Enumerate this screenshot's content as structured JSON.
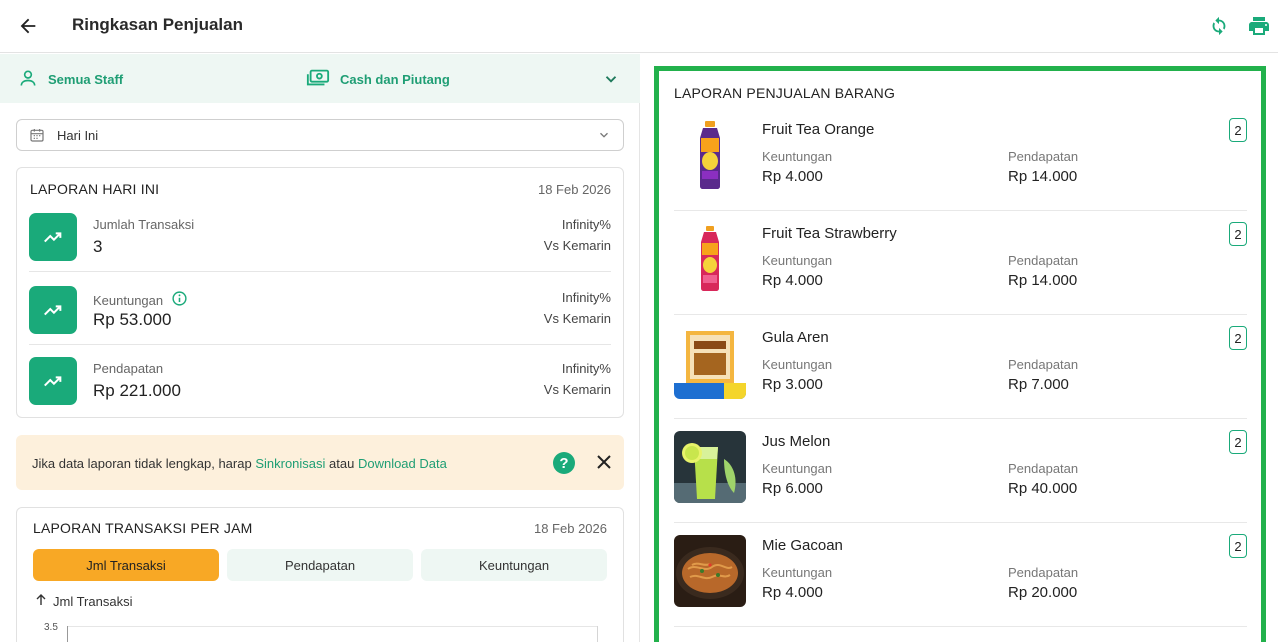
{
  "header": {
    "title": "Ringkasan Penjualan",
    "back_icon": "arrow-left-icon",
    "refresh_icon": "refresh-icon",
    "print_icon": "printer-icon"
  },
  "filters": {
    "staff_label": "Semua Staff",
    "payment_label": "Cash dan Piutang"
  },
  "date_select": {
    "value": "Hari Ini"
  },
  "today_report": {
    "title": "LAPORAN HARI INI",
    "date": "18 Feb 2026",
    "stats": [
      {
        "label": "Jumlah Transaksi",
        "value": "3",
        "pct": "Infinity%",
        "vs": "Vs Kemarin"
      },
      {
        "label": "Keuntungan",
        "value": "Rp 53.000",
        "pct": "Infinity%",
        "vs": "Vs Kemarin"
      },
      {
        "label": "Pendapatan",
        "value": "Rp 221.000",
        "pct": "Infinity%",
        "vs": "Vs Kemarin"
      }
    ]
  },
  "notice": {
    "text_before": "Jika data laporan tidak lengkap, harap ",
    "link_sync": "Sinkronisasi",
    "text_mid": " atau ",
    "link_download": "Download Data",
    "help": "?"
  },
  "hourly_report": {
    "title": "LAPORAN TRANSAKSI PER JAM",
    "date": "18 Feb 2026",
    "tabs": [
      "Jml Transaksi",
      "Pendapatan",
      "Keuntungan"
    ],
    "active_tab": "Jml Transaksi",
    "axis_title": "Jml Transaksi",
    "y_tick_top": "3.5"
  },
  "items_report": {
    "title": "LAPORAN PENJUALAN BARANG",
    "profit_label": "Keuntungan",
    "revenue_label": "Pendapatan",
    "items": [
      {
        "name": "Fruit Tea Orange",
        "qty": "2",
        "profit": "Rp 4.000",
        "revenue": "Rp 14.000"
      },
      {
        "name": "Fruit Tea Strawberry",
        "qty": "2",
        "profit": "Rp 4.000",
        "revenue": "Rp 14.000"
      },
      {
        "name": "Gula Aren",
        "qty": "2",
        "profit": "Rp 3.000",
        "revenue": "Rp 7.000"
      },
      {
        "name": "Jus Melon",
        "qty": "2",
        "profit": "Rp 6.000",
        "revenue": "Rp 40.000"
      },
      {
        "name": "Mie Gacoan",
        "qty": "2",
        "profit": "Rp 4.000",
        "revenue": "Rp 20.000"
      }
    ]
  },
  "colors": {
    "accent": "#1aaa7a",
    "active_tab": "#f8a825",
    "highlight_border": "#22b14c",
    "notice_bg": "#fdf0dc"
  }
}
